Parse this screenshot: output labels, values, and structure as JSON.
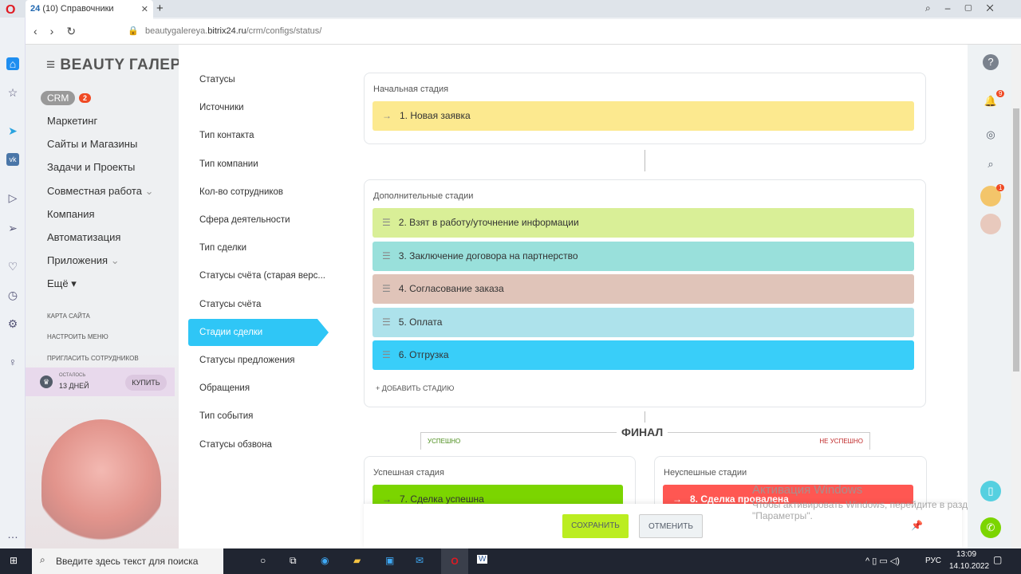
{
  "browser": {
    "tab_badge": "24",
    "tab_title": "(10) Справочники",
    "url_pre": "beautygalereya.",
    "url_domain": "bitrix24.ru",
    "url_path": "/crm/configs/status/"
  },
  "menu": {
    "logo": "BEAUTY ГАЛЕРЕЯ",
    "crm": "CRM",
    "crm_count": "2",
    "items": [
      "Маркетинг",
      "Сайты и Магазины",
      "Задачи и Проекты",
      "Совместная работа",
      "Компания",
      "Автоматизация",
      "Приложения",
      "Ещё"
    ],
    "small": [
      "Карта сайта",
      "Настроить меню",
      "Пригласить сотрудников"
    ],
    "trial_label": "ОСТАЛОСЬ",
    "trial_days": "13 ДНЕЙ",
    "buy": "КУПИТЬ"
  },
  "subnav": [
    "Статусы",
    "Источники",
    "Тип контакта",
    "Тип компании",
    "Кол-во сотрудников",
    "Сфера деятельности",
    "Тип сделки",
    "Статусы счёта (старая верс...",
    "Статусы счёта",
    "Стадии сделки",
    "Статусы предложения",
    "Обращения",
    "Тип события",
    "Статусы обзвона"
  ],
  "initial": {
    "title": "Начальная стадия",
    "stage": "1. Новая заявка",
    "color": "#fce98f"
  },
  "extra": {
    "title": "Дополнительные стадии",
    "stages": [
      {
        "label": "2. Взят в работу/уточнение информации",
        "color": "#d9ef97"
      },
      {
        "label": "3. Заключение договора на партнерство",
        "color": "#99e0db"
      },
      {
        "label": "4. Согласование заказа",
        "color": "#e0c4b9"
      },
      {
        "label": "5. Оплата",
        "color": "#ade2eb"
      },
      {
        "label": "6. Отгрузка",
        "color": "#39cef9"
      }
    ],
    "add": "+ ДОБАВИТЬ СТАДИЮ"
  },
  "final": {
    "title": "ФИНАЛ",
    "success": "УСПЕШНО",
    "fail": "НЕ УСПЕШНО",
    "success_title": "Успешная стадия",
    "success_stage": "7. Сделка успешна",
    "success_color": "#7bd500",
    "fail_title": "Неуспешные стадии",
    "fail_stage": "8. Сделка провалена",
    "fail_color": "#ff5752"
  },
  "buttons": {
    "save": "СОХРАНИТЬ",
    "cancel": "ОТМЕНИТЬ"
  },
  "right": {
    "notif_count": "9",
    "avatar_count": "1"
  },
  "watermark": {
    "title": "Активация Windows",
    "text": "Чтобы активировать Windows, перейдите в раздел \"Параметры\"."
  },
  "taskbar": {
    "search": "Введите здесь текст для поиска",
    "lang": "РУС",
    "time": "13:09",
    "date": "14.10.2022"
  }
}
